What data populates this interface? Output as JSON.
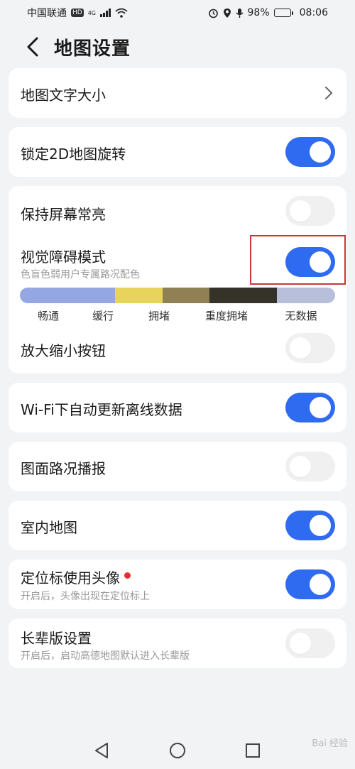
{
  "status_bar": {
    "carrier": "中国联通",
    "hd": "HD",
    "network": "4G",
    "battery": "98%",
    "time": "08:06"
  },
  "header": {
    "title": "地图设置"
  },
  "settings": {
    "text_size": {
      "label": "地图文字大小"
    },
    "lock_2d": {
      "label": "锁定2D地图旋转",
      "enabled": true
    },
    "keep_screen_on": {
      "label": "保持屏幕常亮",
      "enabled": false
    },
    "visual_impairment": {
      "label": "视觉障碍模式",
      "subtitle": "色盲色弱用户专属路况配色",
      "enabled": true
    },
    "zoom_buttons": {
      "label": "放大缩小按钮",
      "enabled": false
    },
    "wifi_update": {
      "label": "Wi-Fi下自动更新离线数据",
      "enabled": true
    },
    "traffic_broadcast": {
      "label": "图面路况播报",
      "enabled": false
    },
    "indoor_map": {
      "label": "室内地图",
      "enabled": true
    },
    "avatar_marker": {
      "label": "定位标使用头像",
      "subtitle": "开启后，头像出现在定位标上",
      "enabled": true
    },
    "elder_mode": {
      "label": "长辈版设置",
      "subtitle": "开启后，启动高德地图默认进入长辈版",
      "enabled": false
    }
  },
  "traffic_legend": [
    {
      "label": "畅通",
      "color": "#95a7e2"
    },
    {
      "label": "缓行",
      "color": "#e8d45c"
    },
    {
      "label": "拥堵",
      "color": "#8f8154"
    },
    {
      "label": "重度拥堵",
      "color": "#35322a"
    },
    {
      "label": "无数据",
      "color": "#b7bfda"
    }
  ],
  "colors": {
    "accent": "#2f6bf0",
    "highlight_border": "#c8383a",
    "notification_dot": "#e8312f"
  },
  "watermark": "Bai 经验"
}
